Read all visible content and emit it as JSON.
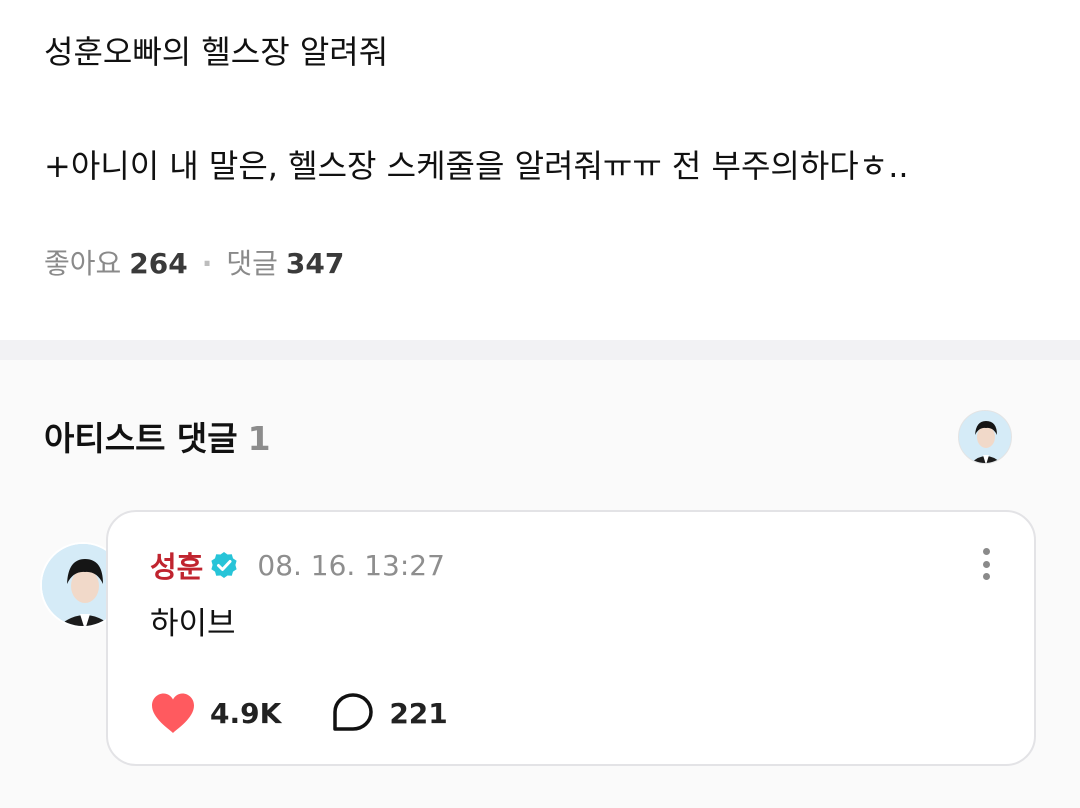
{
  "post": {
    "line1": "성훈오빠의 헬스장 알려줘",
    "line2": "+아니이 내 말은, 헬스장 스케줄을 알려줘ㅠㅠ 전 부주의하다ㅎ..",
    "likes_label": "좋아요",
    "likes_count": "264",
    "separator": "·",
    "comments_label": "댓글",
    "comments_count": "347"
  },
  "artist_comments": {
    "title": "아티스트 댓글",
    "count": "1",
    "comment": {
      "author": "성훈",
      "verified": true,
      "timestamp": "08. 16. 13:27",
      "text": "하이브",
      "likes": "4.9K",
      "replies": "221"
    }
  },
  "colors": {
    "author_name": "#c0242f",
    "verified_badge": "#27c4d8",
    "heart": "#ff5a5f",
    "divider": "#f2f2f4"
  },
  "icons": [
    "verified-badge-icon",
    "more-vertical-icon",
    "heart-icon",
    "comment-bubble-icon",
    "avatar"
  ]
}
